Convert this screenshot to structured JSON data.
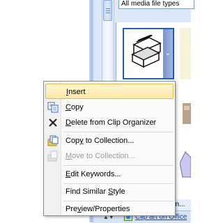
{
  "header": {
    "media_filter_value": "All media file types"
  },
  "context_menu": {
    "items": [
      {
        "label": "Insert",
        "underline": "I",
        "enabled": true,
        "highlighted": true,
        "icon": "none"
      },
      {
        "label": "Copy",
        "underline": "C",
        "enabled": true,
        "highlighted": false,
        "icon": "copy-icon"
      },
      {
        "label": "Delete from Clip Organizer",
        "underline": "D",
        "enabled": true,
        "highlighted": false,
        "icon": "delete-x-icon"
      },
      {
        "label": "Copy to Collection...",
        "underline": "y",
        "enabled": true,
        "highlighted": false,
        "icon": "copy-to-collection-icon"
      },
      {
        "label": "Move to Collection...",
        "underline": "M",
        "enabled": false,
        "highlighted": false,
        "icon": "move-to-collection-icon"
      },
      {
        "label": "Edit Keywords...",
        "underline": "E",
        "enabled": true,
        "highlighted": false,
        "icon": "none"
      },
      {
        "label": "Find Similar Style",
        "underline": "S",
        "enabled": true,
        "highlighted": false,
        "icon": "none"
      },
      {
        "label": "Preview/Properties",
        "underline": "v",
        "enabled": true,
        "highlighted": false,
        "icon": "none"
      }
    ]
  },
  "status": {
    "partial_text": "on..."
  },
  "footer": {
    "link_text": "Clip art on Office"
  },
  "colors": {
    "menu_highlight": "#fde7a4",
    "pane_background": "#dde8f7",
    "link": "#1a47a8"
  }
}
